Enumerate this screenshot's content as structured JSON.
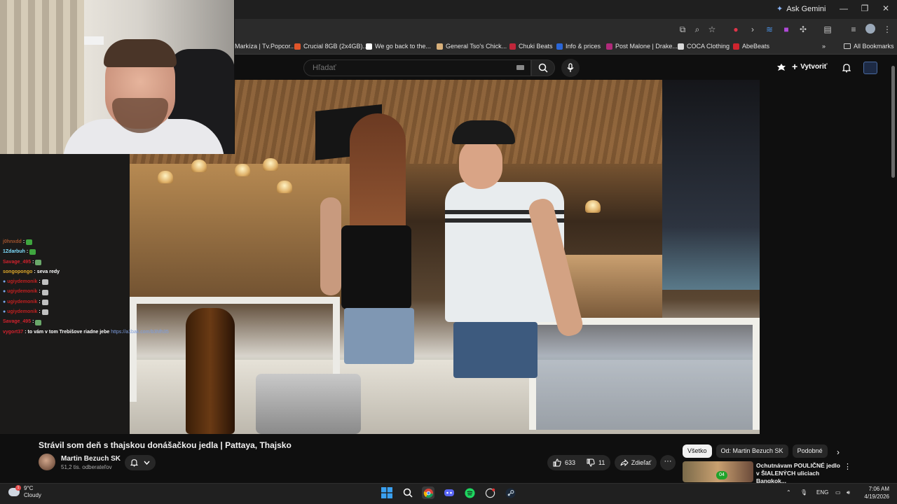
{
  "browser": {
    "ask_gemini": "Ask Gemini",
    "bookmarks": [
      {
        "label": "Markíza | Tv.Popcor...",
        "color": "#1f1f1f"
      },
      {
        "label": "Crucial 8GB (2x4GB)...",
        "color": "#e0552a"
      },
      {
        "label": "We go back to the...",
        "color": "#ffffff"
      },
      {
        "label": "General Tso's Chick...",
        "color": "#d8b07a"
      },
      {
        "label": "Chuki Beats",
        "color": "#c0263a"
      },
      {
        "label": "Info & prices",
        "color": "#2a66d8"
      },
      {
        "label": "Post Malone | Drake...",
        "color": "#b02a7a"
      },
      {
        "label": "COCA Clothing",
        "color": "#d9d9d9"
      },
      {
        "label": "AbeBeats",
        "color": "#d0242e"
      }
    ],
    "all_bookmarks": "All Bookmarks"
  },
  "youtube": {
    "search_placeholder": "Hľadať",
    "create_label": "Vytvoriť"
  },
  "chat": [
    {
      "nick": "j0hnxdd",
      "color": "#a0522d",
      "msg": "",
      "emote": "#3fa63f"
    },
    {
      "nick": "1Zdarbuh",
      "color": "#7fdfff",
      "msg": "",
      "emote": "#3fa63f"
    },
    {
      "nick": "Savage_495",
      "color": "#d2222d",
      "msg": "",
      "emote": "#6aa86a"
    },
    {
      "nick": "songopongo",
      "color": "#e0a82a",
      "msg": "seva redy",
      "emote": ""
    },
    {
      "nick": "ugiydemonik",
      "color": "#c02020",
      "msg": "",
      "emote": "#c0c0c0"
    },
    {
      "nick": "ugiydemonik",
      "color": "#c02020",
      "msg": "",
      "emote": "#c0c0c0"
    },
    {
      "nick": "ugiydemonik",
      "color": "#c02020",
      "msg": "",
      "emote": "#c0c0c0"
    },
    {
      "nick": "ugiydemonik",
      "color": "#c02020",
      "msg": "",
      "emote": "#c0c0c0"
    },
    {
      "nick": "Savage_495",
      "color": "#d2222d",
      "msg": "",
      "emote": "#6aa86a"
    },
    {
      "nick": "vygort37",
      "color": "#d2222d",
      "msg": "to vám v tom Trebišove riadne jebe",
      "link": "https://a1bak.com/b3hfh35",
      "emote": ""
    }
  ],
  "video": {
    "title": "Strávil som deň s thajskou donášačkou jedla | Pattaya, Thajsko",
    "channel": "Martin Bezuch SK",
    "subscribers": "51,2 tis. odberateľov",
    "likes": "633",
    "dislikes": "11",
    "share_label": "Zdieľať"
  },
  "chips": [
    "Všetko",
    "Od: Martin Bezuch SK",
    "Podobné"
  ],
  "recommendation": {
    "title": "Ochutnávam POULIČNÉ jedlo v ŠIALENÝCH uliciach Bangkok...",
    "badge": "04"
  },
  "taskbar": {
    "temp": "9°C",
    "condition": "Cloudy",
    "weather_badge": "1",
    "lang": "ENG",
    "time": "7:06 AM",
    "date": "4/19/2026"
  }
}
